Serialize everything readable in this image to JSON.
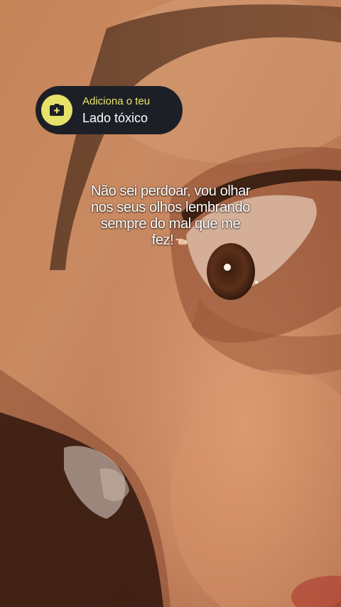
{
  "sticker": {
    "title": "Adiciona o teu",
    "subtitle": "Lado tóxico",
    "icon": "camera-plus-icon",
    "accent_color": "#e7e26a",
    "background_color": "#1d1f26"
  },
  "caption": {
    "lines": [
      "Não sei perdoar, vou olhar",
      "nos seus olhos lembrando",
      "sempre do mal que me",
      "fez!"
    ],
    "emoji": "pointing-hand-emoji"
  },
  "background": {
    "description_icon": "close-up-face-photo"
  }
}
